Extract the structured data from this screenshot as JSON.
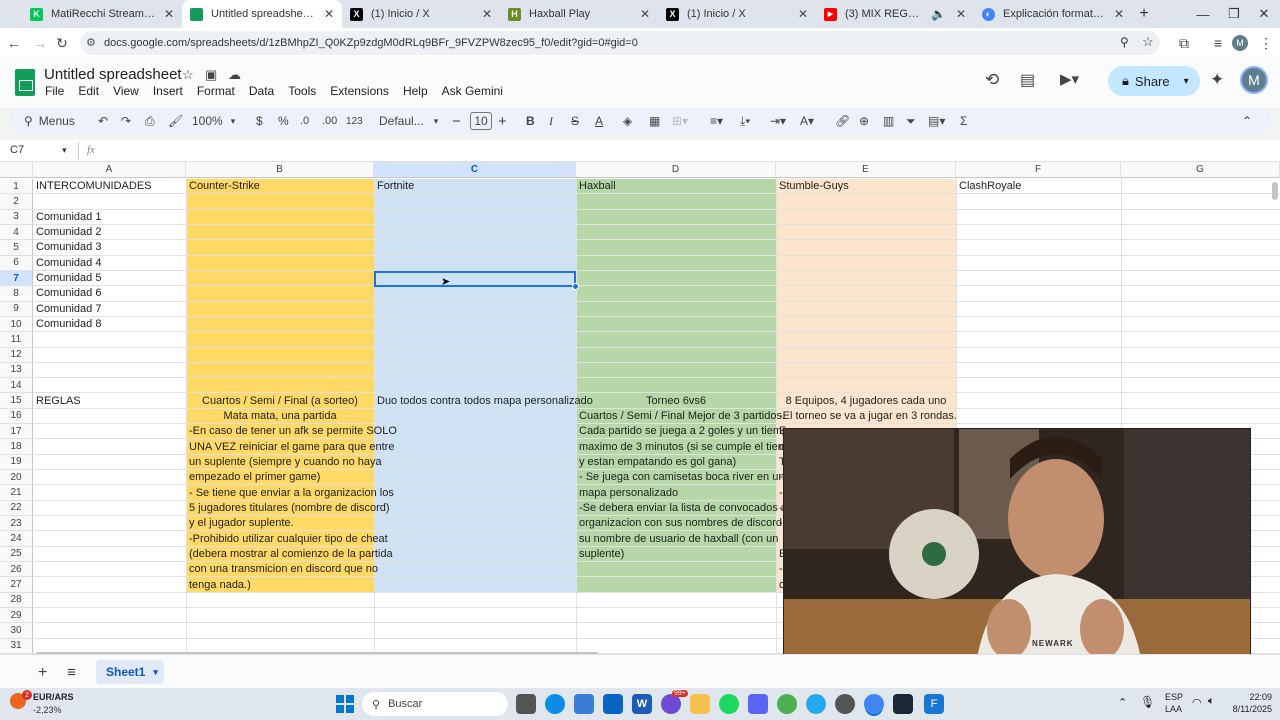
{
  "browser": {
    "tabs": [
      {
        "title": "MatiRecchi Stream - Watch Live",
        "favicon_color": "#00c853",
        "favicon_glyph": "K"
      },
      {
        "title": "Untitled spreadsheet - Google Sheets",
        "favicon_color": "#0f9d58",
        "favicon_glyph": ""
      },
      {
        "title": "(1) Inicio / X",
        "favicon_color": "#000000",
        "favicon_glyph": "X"
      },
      {
        "title": "Haxball Play",
        "favicon_color": "#6b8e23",
        "favicon_glyph": "H"
      },
      {
        "title": "(1) Inicio / X",
        "favicon_color": "#000000",
        "favicon_glyph": "X"
      },
      {
        "title": "(3) MIX REGGAETON 2021",
        "favicon_color": "#ff0000",
        "favicon_glyph": "▶"
      },
      {
        "title": "Explicación formato torneo",
        "favicon_color": "#4285f4",
        "favicon_glyph": "◐"
      }
    ],
    "new_tab": "+",
    "url": "docs.google.com/spreadsheets/d/1zBMhpZI_Q0KZp9zdgM0dRLq9BFr_9FVZPW8zec95_f0/edit?gid=0#gid=0"
  },
  "doc": {
    "title": "Untitled spreadsheet",
    "menus": [
      "File",
      "Edit",
      "View",
      "Insert",
      "Format",
      "Data",
      "Tools",
      "Extensions",
      "Help",
      "Ask Gemini"
    ],
    "share_label": "Share",
    "avatar_letter": "M"
  },
  "toolbar": {
    "search_label": "Menus",
    "zoom": "100%",
    "currency": "$",
    "percent": "%",
    "dec_minus": ".0",
    "dec_plus": ".00",
    "num_format": "123",
    "font": "Defaul...",
    "font_size": "10"
  },
  "formula": {
    "name_box": "C7",
    "fx": "fx"
  },
  "grid": {
    "columns": [
      "A",
      "B",
      "C",
      "D",
      "E",
      "F",
      "G"
    ],
    "rows": [
      "1",
      "2",
      "3",
      "4",
      "5",
      "6",
      "7",
      "8",
      "9",
      "10",
      "11",
      "12",
      "13",
      "14",
      "15",
      "16",
      "17",
      "18",
      "19",
      "20",
      "21",
      "22",
      "23",
      "24",
      "25",
      "26",
      "27",
      "28",
      "29",
      "30",
      "31"
    ],
    "header_row": {
      "A": "INTERCOMUNIDADES",
      "B": "Counter-Strike",
      "C": "Fortnite",
      "D": "Haxball",
      "E": "Stumble-Guys",
      "F": "ClashRoyale"
    },
    "communities": [
      "Comunidad 1",
      "Comunidad 2",
      "Comunidad 3",
      "Comunidad 4",
      "Comunidad 5",
      "Comunidad 6",
      "Comunidad 7",
      "Comunidad 8"
    ],
    "rules_label": "REGLAS",
    "rules": {
      "B15": "Cuartos / Semi / Final (a sorteo)",
      "B16": "Mata mata, una partida",
      "B_lines": [
        "-En caso de tener un afk se permite SOLO",
        "UNA VEZ reiniciar el game para que entre",
        "un suplente (siempre y cuando no haya",
        "empezado el primer game)",
        "- Se tiene que enviar a la organizacion los",
        "5 jugadores titulares (nombre de discord)",
        "y el jugador suplente.",
        "-Prohibido utilizar cualquier tipo de cheat",
        "(debera mostrar al comienzo de la partida",
        "con una transmicion en discord que no",
        "tenga nada.)"
      ],
      "C15": "Duo todos contra todos mapa personalizado",
      "D15": "Torneo 6vs6",
      "D_lines": [
        "Cuartos / Semi / Final Mejor de 3 partidos.",
        "Cada partido se juega a 2 goles y un tiempo",
        "maximo de 3 minutos (si se cumple el tiempo",
        "y estan empatando es gol gana)",
        "- Se juega con camisetas boca river en un",
        "mapa personalizado",
        "-Se debera enviar la lista de convocados a la",
        "organizacion con sus nombres de discord y",
        "su nombre de usuario de haxball (con un",
        "suplente)"
      ],
      "E15": "8 Equipos, 4 jugadores cada uno",
      "E16": "-El torneo se va a jugar en 3 rondas.",
      "E_partial": [
        "E",
        "d",
        "T",
        "-",
        "-",
        "-",
        "-",
        "E",
        "-",
        "c"
      ]
    },
    "colors": {
      "B": "#ffd966",
      "C": "#cfe2f3",
      "D": "#b6d7a8",
      "E": "#fce5cd",
      "selection": "#1a73e8"
    }
  },
  "sheets": {
    "active": "Sheet1"
  },
  "taskbar": {
    "currency_pair": "EUR/ARS",
    "currency_change": "-2,23%",
    "notif_count": "2",
    "search_placeholder": "Buscar",
    "lang_top": "ESP",
    "lang_bottom": "LAA",
    "time": "22:09",
    "date": "8/11/2025",
    "badge_99": "99+"
  },
  "webcam_text": "NEWARK"
}
